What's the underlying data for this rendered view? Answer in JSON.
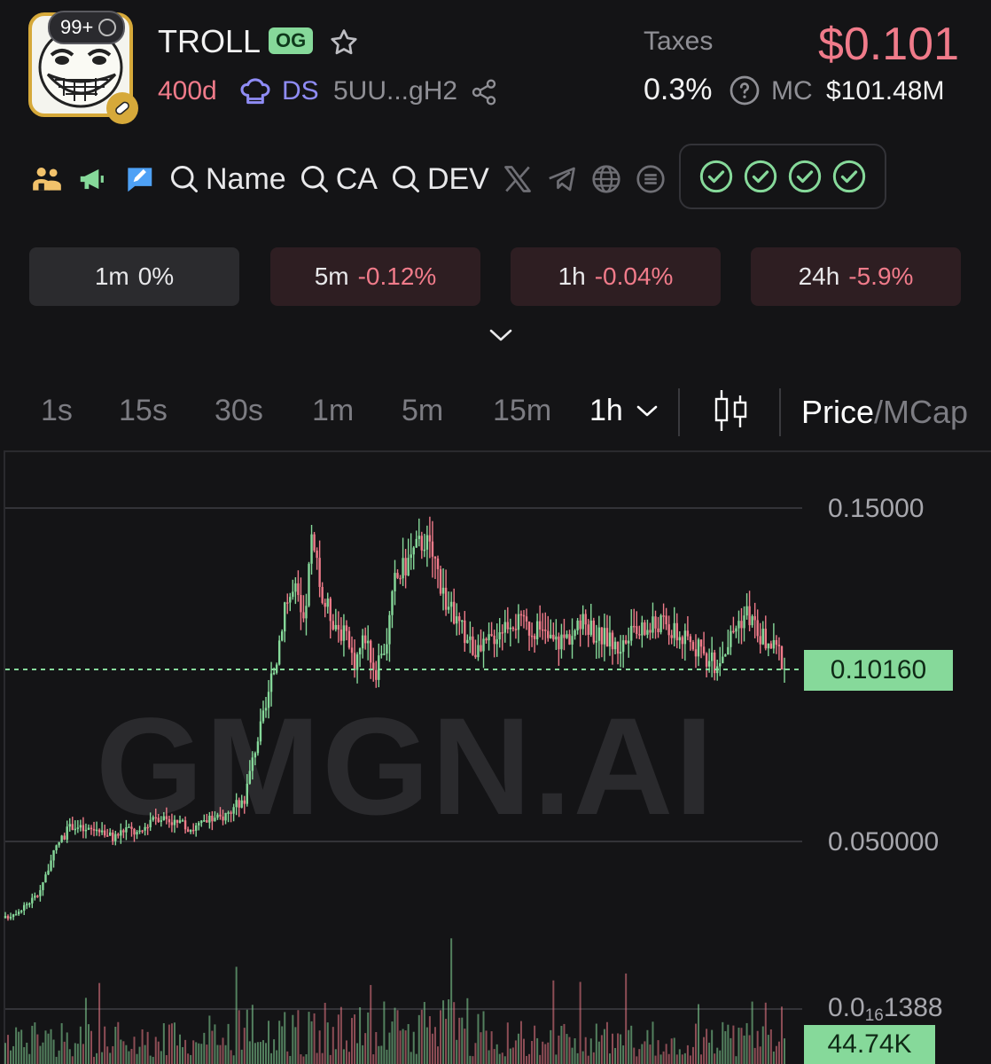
{
  "token": {
    "notification_count": "99+",
    "name": "TROLL",
    "og_badge": "OG",
    "age": "400d",
    "dev_tag": "DS",
    "address": "5UU...gH2"
  },
  "header_right": {
    "taxes_label": "Taxes",
    "price": "$0.101",
    "taxes_value": "0.3%",
    "mc_label": "MC",
    "mc_value": "$101.48M"
  },
  "search_links": {
    "name": "Name",
    "ca": "CA",
    "dev": "DEV"
  },
  "checks_count": 4,
  "stats": [
    {
      "label": "1m",
      "value": "0%",
      "trend": "neutral"
    },
    {
      "label": "5m",
      "value": "-0.12%",
      "trend": "down"
    },
    {
      "label": "1h",
      "value": "-0.04%",
      "trend": "down"
    },
    {
      "label": "24h",
      "value": "-5.9%",
      "trend": "down"
    }
  ],
  "timeframes": [
    "1s",
    "15s",
    "30s",
    "1m",
    "5m",
    "15m",
    "1h"
  ],
  "active_timeframe": "1h",
  "price_toggle": {
    "active": "Price",
    "separator": "/",
    "other": "MCap"
  },
  "colors": {
    "up": "#86d99a",
    "down": "#f07b8a",
    "accent_gold": "#d6a93a",
    "dev_purple": "#8f8cf5"
  },
  "chart": {
    "watermark": "GMGN.AI",
    "current_price_label": "0.10160",
    "volume_label": "44.74K"
  },
  "chart_data": {
    "type": "candlestick",
    "title": "",
    "xlabel": "",
    "ylabel": "",
    "y_tick_labels": [
      "0.15000",
      "0.050000",
      "0.0₁1388"
    ],
    "y_tick_label_low_parts": {
      "prefix": "0.0",
      "sub": "16",
      "rest": "1388"
    },
    "y_ticks": [
      0.15,
      0.05
    ],
    "current_price": 0.1016,
    "current_volume": "44.74K",
    "ylim": [
      0.015,
      0.16
    ],
    "grid": true,
    "trend": [
      [
        0,
        0.027
      ],
      [
        6,
        0.03
      ],
      [
        12,
        0.034
      ],
      [
        16,
        0.042
      ],
      [
        20,
        0.05
      ],
      [
        25,
        0.055
      ],
      [
        30,
        0.053
      ],
      [
        35,
        0.054
      ],
      [
        40,
        0.051
      ],
      [
        45,
        0.054
      ],
      [
        50,
        0.052
      ],
      [
        55,
        0.058
      ],
      [
        60,
        0.057
      ],
      [
        65,
        0.055
      ],
      [
        70,
        0.054
      ],
      [
        75,
        0.056
      ],
      [
        80,
        0.057
      ],
      [
        85,
        0.06
      ],
      [
        89,
        0.063
      ],
      [
        93,
        0.078
      ],
      [
        97,
        0.09
      ],
      [
        101,
        0.105
      ],
      [
        104,
        0.122
      ],
      [
        108,
        0.125
      ],
      [
        111,
        0.114
      ],
      [
        114,
        0.14
      ],
      [
        118,
        0.123
      ],
      [
        122,
        0.117
      ],
      [
        126,
        0.112
      ],
      [
        130,
        0.104
      ],
      [
        134,
        0.112
      ],
      [
        138,
        0.1
      ],
      [
        142,
        0.111
      ],
      [
        145,
        0.128
      ],
      [
        149,
        0.133
      ],
      [
        152,
        0.137
      ],
      [
        156,
        0.141
      ],
      [
        160,
        0.134
      ],
      [
        164,
        0.122
      ],
      [
        168,
        0.116
      ],
      [
        172,
        0.111
      ],
      [
        176,
        0.106
      ],
      [
        180,
        0.11
      ],
      [
        184,
        0.114
      ],
      [
        188,
        0.117
      ],
      [
        192,
        0.115
      ],
      [
        196,
        0.114
      ],
      [
        200,
        0.112
      ],
      [
        204,
        0.11
      ],
      [
        208,
        0.111
      ],
      [
        212,
        0.113
      ],
      [
        216,
        0.116
      ],
      [
        220,
        0.112
      ],
      [
        224,
        0.111
      ],
      [
        228,
        0.108
      ],
      [
        232,
        0.111
      ],
      [
        236,
        0.113
      ],
      [
        240,
        0.114
      ],
      [
        244,
        0.116
      ],
      [
        248,
        0.113
      ],
      [
        252,
        0.111
      ],
      [
        256,
        0.109
      ],
      [
        260,
        0.106
      ],
      [
        264,
        0.103
      ],
      [
        268,
        0.108
      ],
      [
        272,
        0.115
      ],
      [
        276,
        0.119
      ],
      [
        280,
        0.113
      ],
      [
        284,
        0.109
      ],
      [
        288,
        0.107
      ],
      [
        290,
        0.102
      ]
    ]
  }
}
